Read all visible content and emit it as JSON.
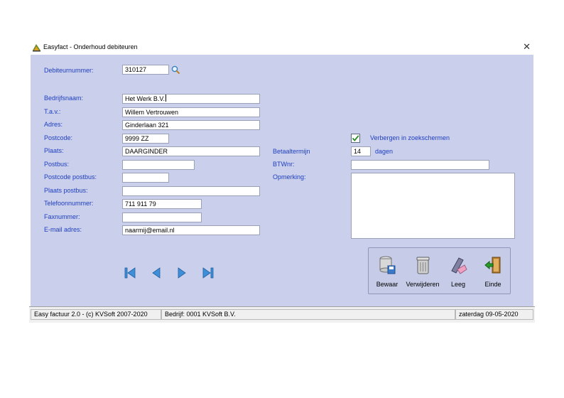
{
  "window": {
    "title": "Easyfact - Onderhoud debiteuren",
    "close_glyph": "✕",
    "icon": "easyfact-app-icon"
  },
  "form": {
    "debiteurnummer": {
      "label": "Debiteurnummer:",
      "value": "310127"
    },
    "bedrijfsnaam": {
      "label": "Bedrijfsnaam:",
      "value": "Het Werk B.V."
    },
    "tav": {
      "label": "T.a.v.:",
      "value": "Willem Vertrouwen"
    },
    "adres": {
      "label": "Adres:",
      "value": "Ginderlaan 321"
    },
    "postcode": {
      "label": "Postcode:",
      "value": "9999 ZZ"
    },
    "plaats": {
      "label": "Plaats:",
      "value": "DAARGINDER"
    },
    "postbus": {
      "label": "Postbus:",
      "value": ""
    },
    "postcode_postbus": {
      "label": "Postcode postbus:",
      "value": ""
    },
    "plaats_postbus": {
      "label": "Plaats postbus:",
      "value": ""
    },
    "telefoonnummer": {
      "label": "Telefoonnummer:",
      "value": "711 911 79"
    },
    "faxnummer": {
      "label": "Faxnummer:",
      "value": ""
    },
    "email": {
      "label": "E-mail adres:",
      "value": "naarmij@email.nl"
    },
    "verbergen": {
      "label": "Verbergen in  zoekschermen",
      "checked": true
    },
    "betaaltermijn": {
      "label": "Betaaltermijn",
      "value": "14",
      "unit": "dagen"
    },
    "btwnr": {
      "label": "BTWnr:",
      "value": ""
    },
    "opmerking": {
      "label": "Opmerking:",
      "value": ""
    }
  },
  "navigation": {
    "icons": [
      "first-record-icon",
      "previous-record-icon",
      "next-record-icon",
      "last-record-icon"
    ]
  },
  "actions": {
    "bewaar": "Bewaar",
    "verwijderen": "Verwijderen",
    "leeg": "Leeg",
    "einde": "Einde"
  },
  "statusbar": {
    "app": "Easy factuur 2.0 - (c) KVSoft 2007-2020",
    "bedrijf": "Bedrijf: 0001 KVSoft B.V.",
    "datum": "zaterdag 09-05-2020"
  },
  "colors": {
    "client_bg": "#cacfec",
    "label_blue": "#1f3fbf",
    "nav_blue": "#3f8fd8",
    "check_green": "#2a8a2a"
  }
}
